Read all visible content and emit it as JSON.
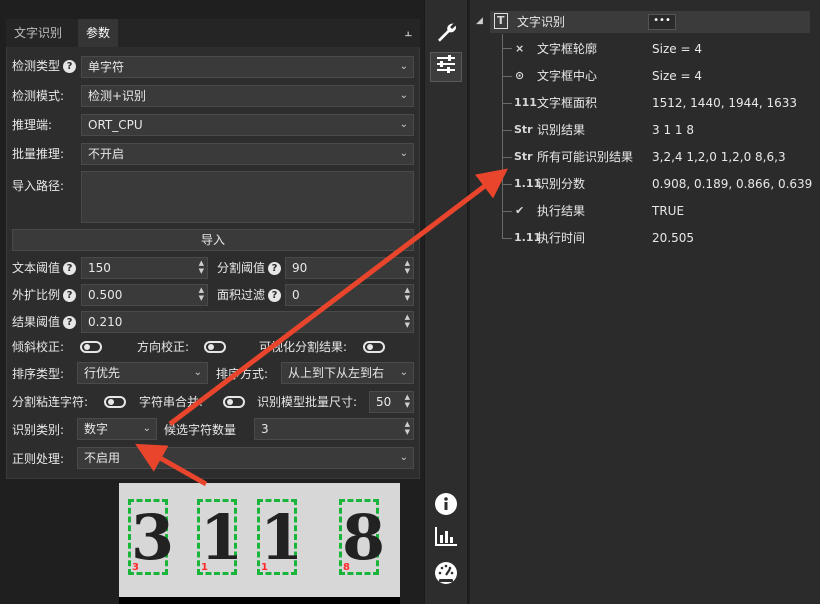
{
  "left_panel": {
    "tabs": [
      {
        "label": "文字识别",
        "active": false
      },
      {
        "label": "参数",
        "active": true
      }
    ],
    "pin_icon": "pin-icon",
    "fields": {
      "detect_type": {
        "label": "检测类型",
        "value": "单字符"
      },
      "detect_mode": {
        "label": "检测模式:",
        "value": "检测+识别"
      },
      "inference": {
        "label": "推理端:",
        "value": "ORT_CPU"
      },
      "batch": {
        "label": "批量推理:",
        "value": "不开启"
      },
      "import_path": {
        "label": "导入路径:",
        "value": ""
      },
      "import_button": "导入",
      "text_threshold": {
        "label": "文本阈值",
        "value": "150"
      },
      "split_threshold": {
        "label": "分割阈值",
        "value": "90"
      },
      "expand_ratio": {
        "label": "外扩比例",
        "value": "0.500"
      },
      "area_filter": {
        "label": "面积过滤",
        "value": "0"
      },
      "result_threshold": {
        "label": "结果阈值",
        "value": "0.210"
      },
      "tilt_correction": {
        "label": "倾斜校正:",
        "on": false
      },
      "direction_correction": {
        "label": "方向校正:",
        "on": false
      },
      "visualize_split": {
        "label": "可视化分割结果:",
        "on": false
      },
      "sort_type": {
        "label": "排序类型:",
        "value": "行优先"
      },
      "sort_method": {
        "label": "排序方式:",
        "value": "从上到下从左到右"
      },
      "split_sticky": {
        "label": "分割粘连字符:",
        "on": false
      },
      "char_merge": {
        "label": "字符串合并:",
        "on": false
      },
      "batch_size": {
        "label": "识别模型批量尺寸:",
        "value": "50"
      },
      "recog_class": {
        "label": "识别类别:",
        "value": "数字"
      },
      "candidate_count": {
        "label": "候选字符数量",
        "value": "3"
      },
      "regex": {
        "label": "正则处理:",
        "value": "不启用"
      }
    }
  },
  "preview": {
    "chars": [
      {
        "glyph": "3",
        "index": "3"
      },
      {
        "glyph": "1",
        "index": "1"
      },
      {
        "glyph": "1",
        "index": "1"
      },
      {
        "glyph": "8",
        "index": "8"
      }
    ],
    "box_color": "#19b43a",
    "index_color": "#ff2a2a"
  },
  "toolbar": {
    "items": [
      "wrench-icon",
      "sliders-icon",
      "info-icon",
      "bar-chart-icon",
      "gauge-icon"
    ]
  },
  "result_tree": {
    "root": {
      "label": "文字识别",
      "more": "•••"
    },
    "items": [
      {
        "icon": "contour-icon",
        "label": "文字框轮廓",
        "value": "Size = 4"
      },
      {
        "icon": "center-icon",
        "label": "文字框中心",
        "value": "Size = 4"
      },
      {
        "icon": "int-array-icon",
        "label": "文字框面积",
        "value": "1512, 1440, 1944, 1633"
      },
      {
        "icon": "string-icon",
        "label": "识别结果",
        "value": "3 1 1 8"
      },
      {
        "icon": "string-array-icon",
        "label": "所有可能识别结果",
        "value": "3,2,4 1,2,0 1,2,0 8,6,3"
      },
      {
        "icon": "float-array-icon",
        "label": "识别分数",
        "value": "0.908, 0.189, 0.866, 0.639"
      },
      {
        "icon": "bool-icon",
        "label": "执行结果",
        "value": "TRUE"
      },
      {
        "icon": "float-icon",
        "label": "执行时间",
        "value": "20.505"
      }
    ]
  },
  "annotation": {
    "arrow_color": "#e8452c"
  }
}
